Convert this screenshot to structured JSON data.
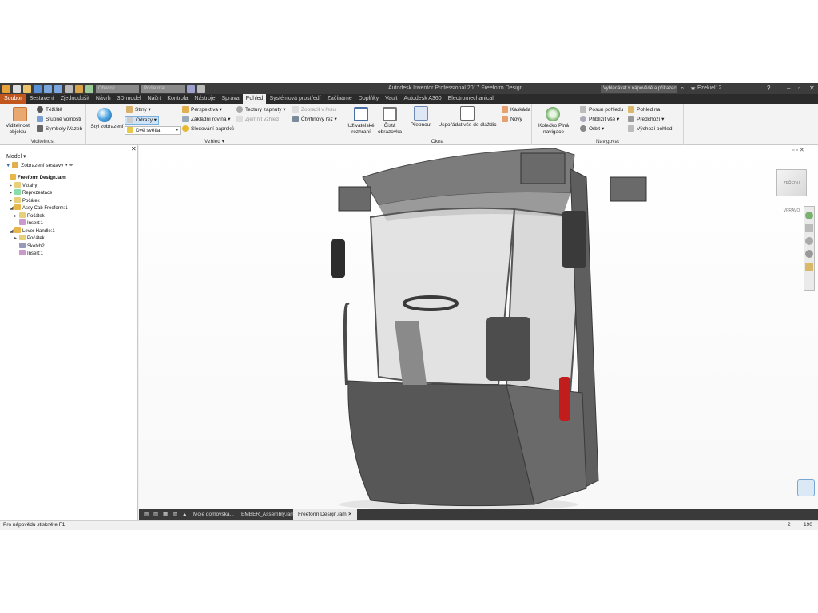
{
  "titlebar": {
    "title": "Autodesk Inventor Professional 2017   Freeform Design",
    "material_dd": "Obecný",
    "appearance_dd": "Podle mat",
    "help_search": "Vyhledávat v nápovědě a příkazech",
    "user": "Ezekiel12"
  },
  "tabs": [
    "Soubor",
    "Sestavení",
    "Zjednodušit",
    "Návrh",
    "3D model",
    "Náčrt",
    "Kontrola",
    "Nástroje",
    "Správa",
    "Pohled",
    "Systémová prostředí",
    "Začínáme",
    "Doplňky",
    "Vault",
    "Autodesk A360",
    "Electromechanical"
  ],
  "active_tab": "Pohled",
  "ribbon": {
    "visibility": {
      "title": "Viditelnost",
      "big": "Viditelnost objektu",
      "items": [
        "Těžiště",
        "Stupně volnosti",
        "Symboly iVazeb"
      ]
    },
    "appearance": {
      "title": "Vzhled",
      "big": "Styl zobrazení",
      "shadows": "Stíny",
      "reflections": "Odrazy",
      "lights": "Dvě světla",
      "perspective": "Perspektiva",
      "ground": "Základní rovina",
      "raytrace": "Sledování paprsků",
      "textures": "Textury zapnuty",
      "smooth": "Zjemnit vzhled",
      "section_show": "Zobrazit v řezu",
      "quarter_section": "Čtvrtinový řez"
    },
    "windows": {
      "title": "Okna",
      "user_interface": "Uživatelské rozhraní",
      "clean_screen": "Čistá obrazovka",
      "switch": "Přepnout",
      "arrange": "Uspořádat vše do dlaždic",
      "cascade": "Kaskáda",
      "new": "Nový"
    },
    "navigate": {
      "title": "Navigovat",
      "wheel": "Kolečko Plná navigace",
      "pan": "Posun pohledu",
      "zoom_all": "Přiblížit vše",
      "orbit": "Orbit",
      "look_at": "Pohled na",
      "previous": "Předchozí",
      "home": "Výchozí pohled"
    }
  },
  "browser": {
    "header": "Model",
    "view_dd": "Zobrazení sestavy",
    "tree": [
      {
        "label": "Freeform Design.iam",
        "level": 0,
        "bold": true,
        "exp": "",
        "icon": "assembly-icon"
      },
      {
        "label": "Vztahy",
        "level": 1,
        "exp": "▸",
        "icon": "folder-icon"
      },
      {
        "label": "Reprezentace",
        "level": 1,
        "exp": "▸",
        "icon": "representation-icon"
      },
      {
        "label": "Počátek",
        "level": 1,
        "exp": "▸",
        "icon": "folder-icon"
      },
      {
        "label": "Assy Cab Freeform:1",
        "level": 1,
        "exp": "◢",
        "icon": "assembly-icon"
      },
      {
        "label": "Počátek",
        "level": 2,
        "exp": "▸",
        "icon": "folder-icon"
      },
      {
        "label": "Insert:1",
        "level": 2,
        "exp": "",
        "icon": "constraint-icon"
      },
      {
        "label": "Lever Handle:1",
        "level": 1,
        "exp": "◢",
        "icon": "assembly-icon"
      },
      {
        "label": "Počátek",
        "level": 2,
        "exp": "▸",
        "icon": "folder-icon"
      },
      {
        "label": "Sketch2",
        "level": 2,
        "exp": "",
        "icon": "sketch-icon"
      },
      {
        "label": "Insert:1",
        "level": 2,
        "exp": "",
        "icon": "constraint-icon"
      }
    ]
  },
  "viewcube": {
    "face1": "ZPŘEDU",
    "face2": "VPRAVO"
  },
  "doctabs": [
    "Moje domovská...",
    "EMBER_Assembly.iam",
    "Freeform Design.iam"
  ],
  "active_doc": "Freeform Design.iam",
  "status": {
    "text": "Pro nápovědu stiskněte F1",
    "num1": "2",
    "num2": "190"
  },
  "colors": {
    "file_tab": "#c1571f",
    "titlebar": "#3c3c3c",
    "tabbar": "#2b2b2b",
    "accent": "#2b7cd3"
  }
}
